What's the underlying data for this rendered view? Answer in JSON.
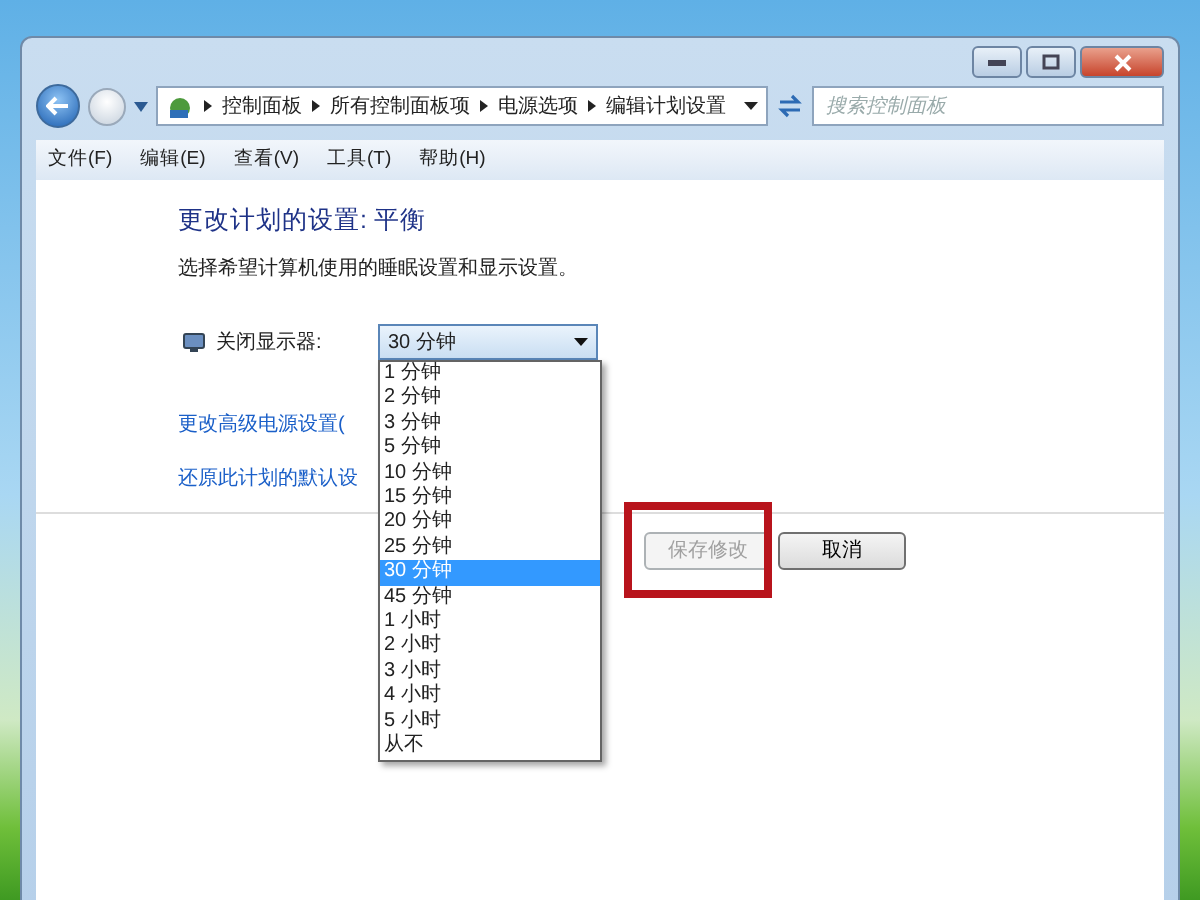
{
  "breadcrumbs": [
    "控制面板",
    "所有控制面板项",
    "电源选项",
    "编辑计划设置"
  ],
  "search": {
    "placeholder": "搜索控制面板"
  },
  "menu": [
    "文件(F)",
    "编辑(E)",
    "查看(V)",
    "工具(T)",
    "帮助(H)"
  ],
  "heading": "更改计划的设置: 平衡",
  "description": "选择希望计算机使用的睡眠设置和显示设置。",
  "setting": {
    "label": "关闭显示器:",
    "value": "30 分钟",
    "expanded": true,
    "options": [
      {
        "label": "1 分钟",
        "selected": false
      },
      {
        "label": "2 分钟",
        "selected": false
      },
      {
        "label": "3 分钟",
        "selected": false
      },
      {
        "label": "5 分钟",
        "selected": false
      },
      {
        "label": "10 分钟",
        "selected": false
      },
      {
        "label": "15 分钟",
        "selected": false
      },
      {
        "label": "20 分钟",
        "selected": false
      },
      {
        "label": "25 分钟",
        "selected": false
      },
      {
        "label": "30 分钟",
        "selected": true
      },
      {
        "label": "45 分钟",
        "selected": false
      },
      {
        "label": "1 小时",
        "selected": false
      },
      {
        "label": "2 小时",
        "selected": false
      },
      {
        "label": "3 小时",
        "selected": false
      },
      {
        "label": "4 小时",
        "selected": false
      },
      {
        "label": "5 小时",
        "selected": false
      },
      {
        "label": "从不",
        "selected": false
      }
    ]
  },
  "links": [
    "更改高级电源设置(",
    "还原此计划的默认设"
  ],
  "buttons": [
    {
      "label": "保存修改",
      "disabled": true,
      "highlighted": true
    },
    {
      "label": "取消",
      "disabled": false,
      "highlighted": false
    }
  ]
}
